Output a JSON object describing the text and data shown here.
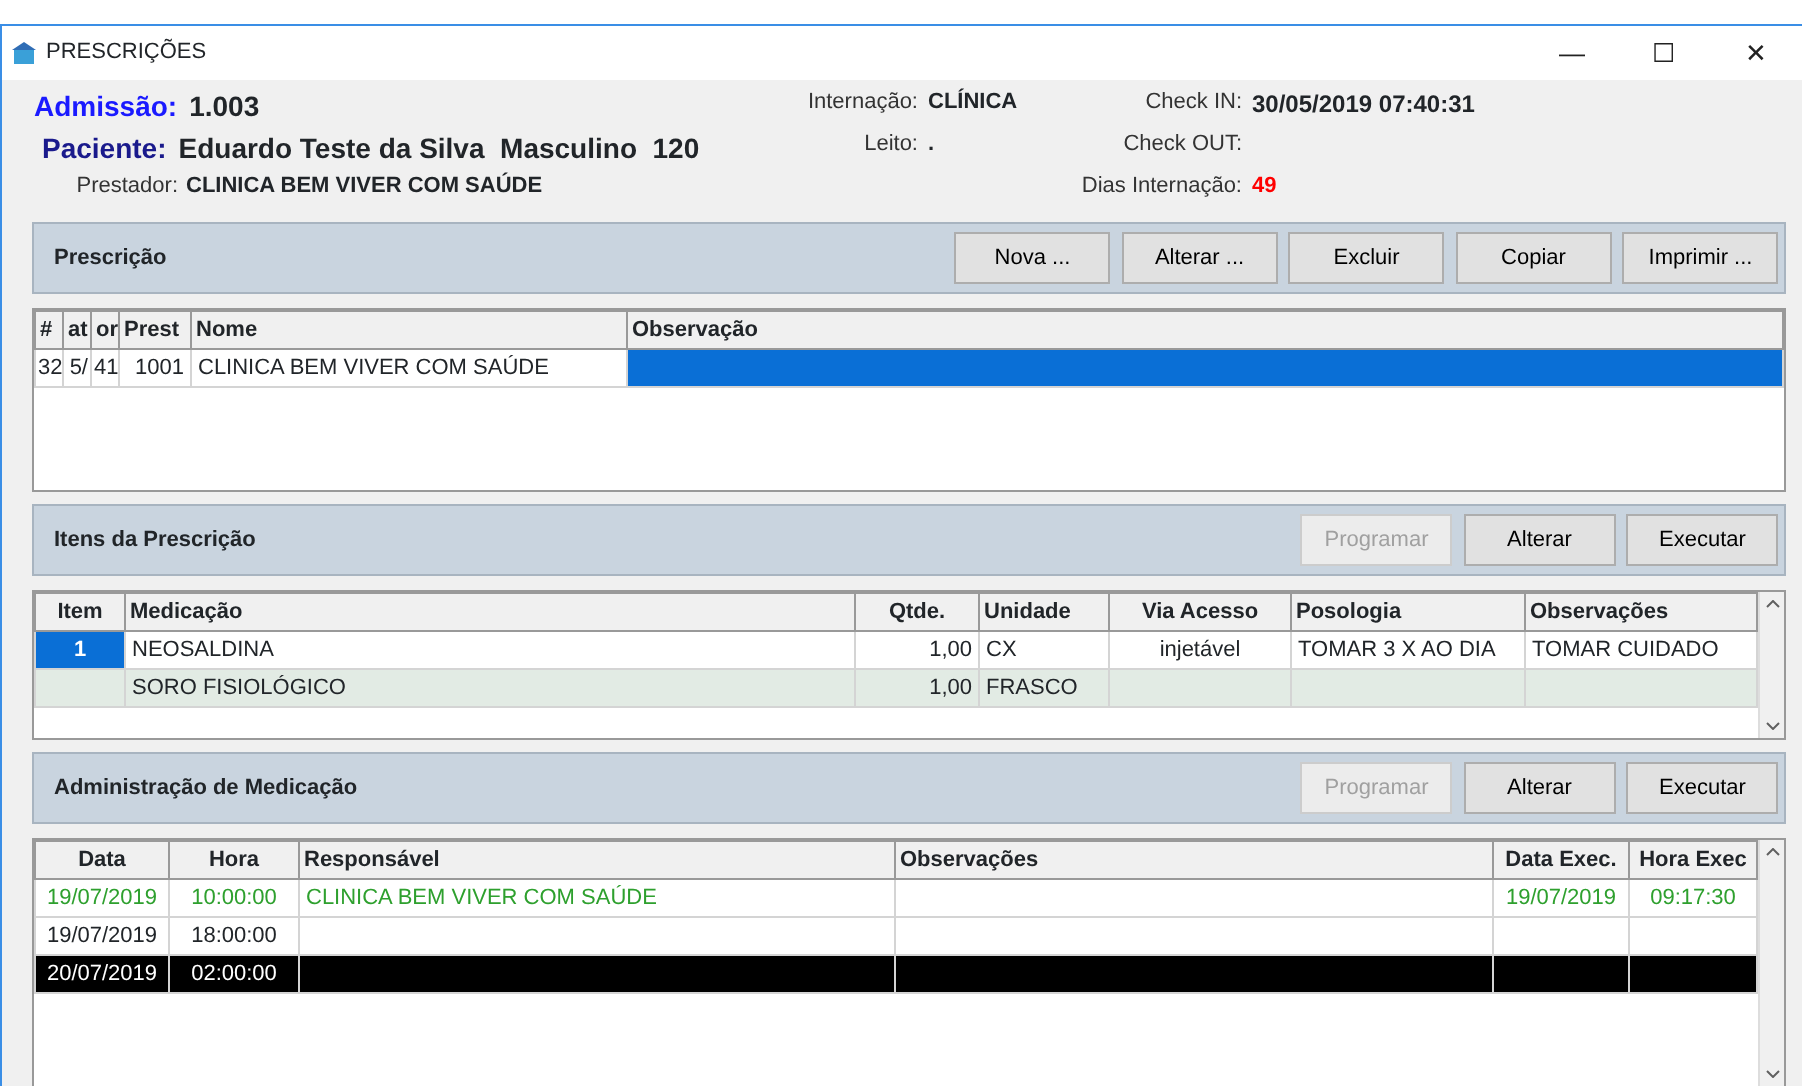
{
  "window": {
    "title": "PRESCRIÇÕES",
    "controls": [
      "—",
      "☐",
      "✕"
    ]
  },
  "header": {
    "admissao": {
      "label": "Admissão:",
      "value": "1.003"
    },
    "paciente": {
      "label": "Paciente:",
      "value": "Eduardo Teste da Silva  Masculino  120"
    },
    "prestador": {
      "label": "Prestador:",
      "value": "CLINICA BEM VIVER COM SAÚDE"
    },
    "internacao": {
      "label": "Internação:",
      "value": "CLÍNICA"
    },
    "leito": {
      "label": "Leito:",
      "value": "."
    },
    "check_in": {
      "label": "Check IN:",
      "value": "30/05/2019 07:40:31"
    },
    "check_out": {
      "label": "Check OUT:"
    },
    "dias": {
      "label": "Dias Internação:",
      "value": "49"
    }
  },
  "sections": [
    {
      "title": "Prescrição",
      "buttons": [
        {
          "label": "Nova ...",
          "disabled": false
        },
        {
          "label": "Alterar ...",
          "disabled": false
        },
        {
          "label": "Excluir",
          "disabled": false
        },
        {
          "label": "Copiar",
          "disabled": false
        },
        {
          "label": "Imprimir ...",
          "disabled": false
        }
      ],
      "columns": [
        "#",
        "at",
        "or",
        "Prest",
        "Nome",
        "Observação"
      ],
      "rows": [
        {
          "cells": [
            "32",
            "5/",
            "41",
            "1001",
            "CLINICA BEM VIVER COM SAÚDE",
            ""
          ],
          "cell_selected": [
            false,
            false,
            false,
            false,
            false,
            true
          ],
          "kind": "normal"
        }
      ]
    },
    {
      "title": "Itens da Prescrição",
      "buttons": [
        {
          "label": "Programar",
          "disabled": true
        },
        {
          "label": "Alterar",
          "disabled": false
        },
        {
          "label": "Executar",
          "disabled": false
        }
      ],
      "columns": [
        "Item",
        "Medicação",
        "Qtde.",
        "Unidade",
        "Via Acesso",
        "Posologia",
        "Observações"
      ],
      "rows": [
        {
          "cells": [
            "1",
            "NEOSALDINA",
            "1,00",
            "CX",
            "injetável",
            "TOMAR 3 X AO DIA",
            "TOMAR CUIDADO"
          ],
          "cell_selected": [
            true,
            false,
            false,
            false,
            false,
            false,
            false
          ],
          "kind": "normal"
        },
        {
          "cells": [
            "",
            "SORO FISIOLÓGICO",
            "1,00",
            "FRASCO",
            "",
            "",
            ""
          ],
          "kind": "shaded"
        }
      ]
    },
    {
      "title": "Administração de Medicação",
      "buttons": [
        {
          "label": "Programar",
          "disabled": true
        },
        {
          "label": "Alterar",
          "disabled": false
        },
        {
          "label": "Executar",
          "disabled": false
        }
      ],
      "columns": [
        "Data",
        "Hora",
        "Responsável",
        "Observações",
        "Data Exec.",
        "Hora Exec"
      ],
      "rows": [
        {
          "cells": [
            "19/07/2019",
            "10:00:00",
            "CLINICA BEM VIVER COM SAÚDE",
            "",
            "19/07/2019",
            "09:17:30"
          ],
          "kind": "executed"
        },
        {
          "cells": [
            "19/07/2019",
            "18:00:00",
            "",
            "",
            "",
            ""
          ],
          "kind": "normal"
        },
        {
          "cells": [
            "20/07/2019",
            "02:00:00",
            "",
            "",
            "",
            ""
          ],
          "kind": "selected"
        }
      ]
    }
  ]
}
